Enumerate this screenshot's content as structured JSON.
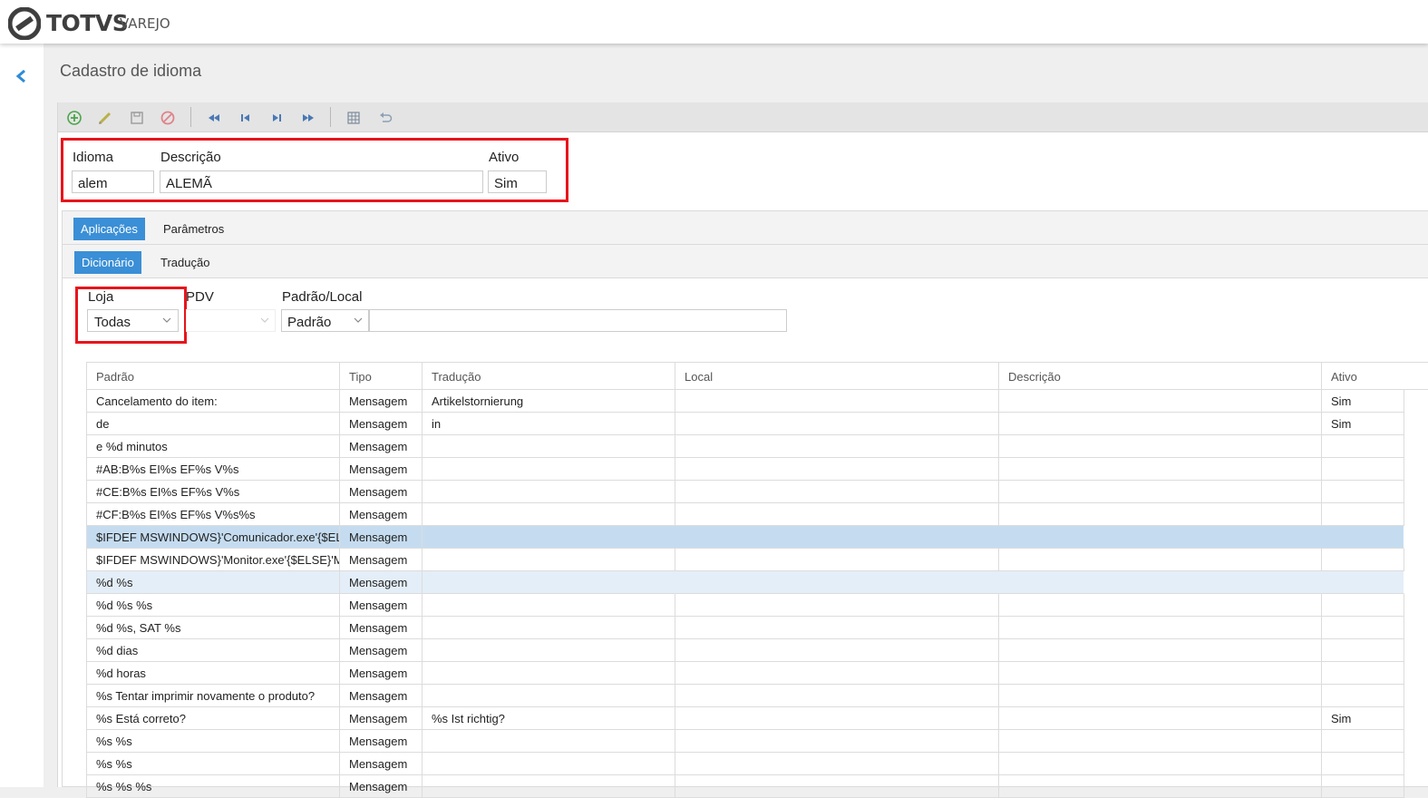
{
  "brand": {
    "name": "TOTVS",
    "product": "VAREJO"
  },
  "page": {
    "title": "Cadastro de idioma"
  },
  "toolbar": {
    "buttons": [
      "add-icon",
      "edit-icon",
      "save-icon",
      "cancel-icon",
      "first-record-icon",
      "previous-record-icon",
      "next-record-icon",
      "last-record-icon",
      "grid-icon",
      "undo-icon"
    ]
  },
  "form": {
    "idioma_label": "Idioma",
    "idioma_value": "alem",
    "descricao_label": "Descrição",
    "descricao_value": "ALEMÃ",
    "ativo_label": "Ativo",
    "ativo_value": "Sim"
  },
  "tabs": {
    "aplicacoes": "Aplicações",
    "parametros": "Parâmetros"
  },
  "subtabs": {
    "dicionario": "Dicionário",
    "traducao": "Tradução"
  },
  "filters": {
    "loja_label": "Loja",
    "loja_value": "Todas",
    "pdv_label": "PDV",
    "pdv_value": "",
    "padrao_local_label": "Padrão/Local",
    "padrao_local_value": "Padrão",
    "search_value": ""
  },
  "grid": {
    "columns": [
      "Padrão",
      "Tipo",
      "Tradução",
      "Local",
      "Descrição",
      "Ativo"
    ],
    "rows": [
      [
        "Cancelamento do item:",
        "Mensagem",
        "Artikelstornierung",
        "",
        "",
        "Sim"
      ],
      [
        "de",
        "Mensagem",
        "in",
        "",
        "",
        "Sim"
      ],
      [
        "e %d minutos",
        "Mensagem",
        "",
        "",
        "",
        ""
      ],
      [
        "#AB:B%s EI%s EF%s V%s",
        "Mensagem",
        "",
        "",
        "",
        ""
      ],
      [
        "#CE:B%s EI%s EF%s V%s",
        "Mensagem",
        "",
        "",
        "",
        ""
      ],
      [
        "#CF:B%s EI%s EF%s V%s%s",
        "Mensagem",
        "",
        "",
        "",
        ""
      ],
      [
        "$IFDEF MSWINDOWS}'Comunicador.exe'{$ELSE}'Comunicador'{$ENDIF}",
        "Mensagem",
        "",
        "",
        "",
        ""
      ],
      [
        "$IFDEF MSWINDOWS}'Monitor.exe'{$ELSE}'Monitor'{$ENDIF}",
        "Mensagem",
        "",
        "",
        "",
        ""
      ],
      [
        "%d %s",
        "Mensagem",
        "",
        "",
        "",
        ""
      ],
      [
        "%d %s %s",
        "Mensagem",
        "",
        "",
        "",
        ""
      ],
      [
        "%d %s, SAT %s",
        "Mensagem",
        "",
        "",
        "",
        ""
      ],
      [
        "%d dias",
        "Mensagem",
        "",
        "",
        "",
        ""
      ],
      [
        "%d horas",
        "Mensagem",
        "",
        "",
        "",
        ""
      ],
      [
        "%s Tentar imprimir novamente o produto?",
        "Mensagem",
        "",
        "",
        "",
        ""
      ],
      [
        "%s Está correto?",
        "Mensagem",
        "%s Ist richtig?",
        "",
        "",
        "Sim"
      ],
      [
        "%s %s",
        "Mensagem",
        "",
        "",
        "",
        ""
      ],
      [
        "%s %s",
        "Mensagem",
        "",
        "",
        "",
        ""
      ],
      [
        "%s %s %s",
        "Mensagem",
        "",
        "",
        "",
        ""
      ]
    ]
  },
  "colors": {
    "accent": "#3a8fd6",
    "highlight": "#e8141c",
    "selected_row": "#c5dcf0"
  }
}
